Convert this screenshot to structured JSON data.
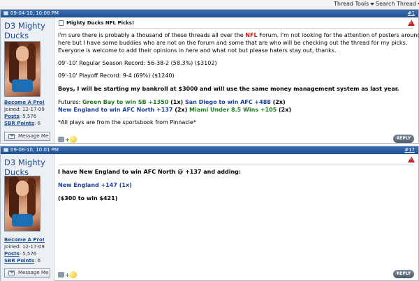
{
  "toolbar": {
    "thread_tools": "Thread Tools",
    "search_thread": "Search Thread"
  },
  "posts": [
    {
      "date": "09-04-10, 10:08 PM",
      "number": "#1",
      "username": "D3 Mighty Ducks",
      "user_links": {
        "become_pro": "Become A Pro!",
        "joined_label": "Joined: 12-17-09",
        "posts_label": "Posts",
        "posts_value": ": 5,576",
        "sbr_label": "SBR Points",
        "sbr_value": ": 6"
      },
      "message_button": "Message Me",
      "title": "Mighty Ducks NFL Picks!",
      "intro_a": "I'm sure there is probably a thousand of these threads all over the ",
      "intro_nfl": "NFL",
      "intro_b": " Forum. I'm not looking for the attention of posters around",
      "intro_line2": "here but I have some buddies who are not on the forum and some that are who will be checking out the thread for my picks.",
      "intro_line3": "Everyone is welcome to add their opinions in here and what not but please haters stay out, thanks.",
      "regular_record": "09'-10' Regular Season Record: 56-38-2 (58.3%) ($3102)",
      "playoff_record": "09'-10' Playoff Record: 9-4 (69%) ($1240)",
      "bankroll": "Boys, I will be starting my bankroll at $3000 and will use the same money management system as last year.",
      "futures_label": "Futures: ",
      "pick1": "Green Bay to win SB +1350",
      "pick1_units": " (1x) ",
      "pick2": "San Diego to win AFC +488",
      "pick2_units": " (2x)",
      "pick3": "New England to win AFC North +137",
      "pick3_units": " (2x) ",
      "pick4": "Miami Under 8.5 Wins +105",
      "pick4_units": " (2x)",
      "note": "*All plays are from the sportsbook from Pinnacle*",
      "reply": "REPLY"
    },
    {
      "date": "09-08-10, 10:01 PM",
      "number": "#17",
      "username": "D3 Mighty Ducks",
      "user_links": {
        "become_pro": "Become A Pro!",
        "joined_label": "Joined: 12-17-09",
        "posts_label": "Posts",
        "posts_value": ": 5,576",
        "sbr_label": "SBR Points",
        "sbr_value": ": 6"
      },
      "message_button": "Message Me",
      "line1": "I have New England to win AFC North @ +137 and adding:",
      "pick": "New England +147 (1x)",
      "amount": "($300 to win $421)",
      "reply": "REPLY"
    }
  ]
}
